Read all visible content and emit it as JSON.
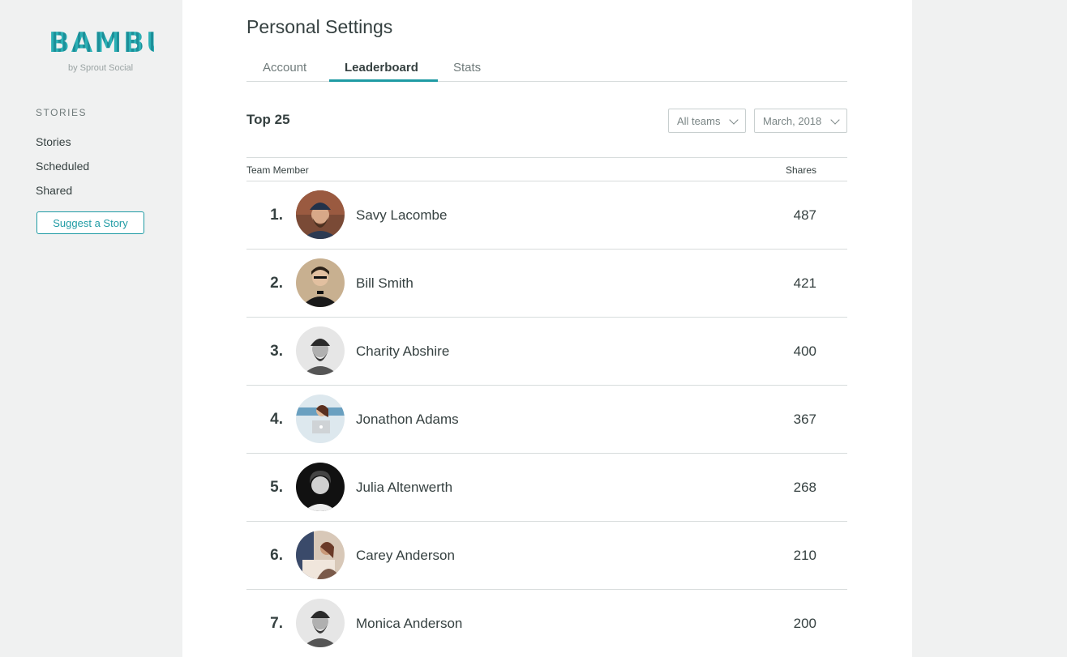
{
  "brand": {
    "name": "BAMBU",
    "sub": "by Sprout Social",
    "accent": "#1f9ba4"
  },
  "sidebar": {
    "heading": "STORIES",
    "items": [
      {
        "label": "Stories"
      },
      {
        "label": "Scheduled"
      },
      {
        "label": "Shared"
      }
    ],
    "suggest_label": "Suggest a Story"
  },
  "main": {
    "title": "Personal Settings",
    "tabs": [
      {
        "label": "Account"
      },
      {
        "label": "Leaderboard",
        "active": true
      },
      {
        "label": "Stats"
      }
    ],
    "section_title": "Top 25",
    "filters": {
      "team": "All teams",
      "month": "March, 2018"
    },
    "table": {
      "headers": {
        "member": "Team Member",
        "shares": "Shares"
      },
      "rows": [
        {
          "rank": "1.",
          "name": "Savy Lacombe",
          "shares": "487",
          "avatar": "avatar-man-beanie-beard"
        },
        {
          "rank": "2.",
          "name": "Bill Smith",
          "shares": "421",
          "avatar": "avatar-man-bowtie"
        },
        {
          "rank": "3.",
          "name": "Charity Abshire",
          "shares": "400",
          "avatar": "avatar-man-beanie-bw"
        },
        {
          "rank": "4.",
          "name": "Jonathon Adams",
          "shares": "367",
          "avatar": "avatar-woman-laptop"
        },
        {
          "rank": "5.",
          "name": "Julia Altenwerth",
          "shares": "268",
          "avatar": "avatar-man-curly-bw"
        },
        {
          "rank": "6.",
          "name": "Carey Anderson",
          "shares": "210",
          "avatar": "avatar-woman-desk"
        },
        {
          "rank": "7.",
          "name": "Monica Anderson",
          "shares": "200",
          "avatar": "avatar-man-beanie-bw"
        }
      ]
    }
  }
}
